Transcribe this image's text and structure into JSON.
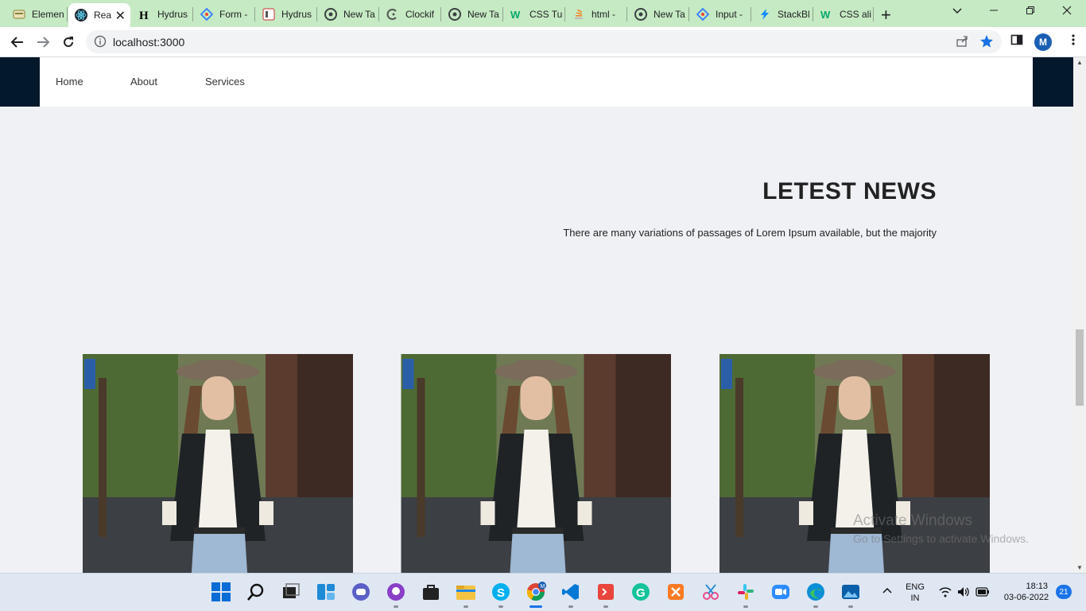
{
  "browser": {
    "tabs": [
      {
        "title": "Elemen",
        "icon": "elementor-icon",
        "active": false
      },
      {
        "title": "Rea",
        "icon": "react-icon",
        "active": true
      },
      {
        "title": "Hydrus",
        "icon": "hydrus-icon",
        "active": false
      },
      {
        "title": "Form -",
        "icon": "google-forms-icon",
        "active": false
      },
      {
        "title": "Hydrus",
        "icon": "hydrus-icon",
        "active": false
      },
      {
        "title": "New Ta",
        "icon": "chrome-icon",
        "active": false
      },
      {
        "title": "Clockif",
        "icon": "clockify-icon",
        "active": false
      },
      {
        "title": "New Ta",
        "icon": "chrome-icon",
        "active": false
      },
      {
        "title": "CSS Tu",
        "icon": "w3schools-icon",
        "active": false
      },
      {
        "title": "html - ",
        "icon": "stackoverflow-icon",
        "active": false
      },
      {
        "title": "New Ta",
        "icon": "chrome-icon",
        "active": false
      },
      {
        "title": "Input -",
        "icon": "google-forms-icon",
        "active": false
      },
      {
        "title": "StackBl",
        "icon": "stackblitz-icon",
        "active": false
      },
      {
        "title": "CSS ali",
        "icon": "w3schools-icon",
        "active": false
      }
    ],
    "url": "localhost:3000",
    "profile_initial": "M"
  },
  "page": {
    "nav": {
      "links": [
        "Home",
        "About",
        "Services"
      ]
    },
    "news": {
      "title": "LETEST NEWS",
      "subtitle": "There are many variations of passages of Lorem Ipsum available, but the majority"
    },
    "cards": [
      {
        "image": "woman-in-hat-street-photo"
      },
      {
        "image": "woman-in-hat-street-photo"
      },
      {
        "image": "woman-in-hat-street-photo"
      }
    ]
  },
  "watermark": {
    "line1": "Activate Windows",
    "line2": "Go to Settings to activate Windows."
  },
  "taskbar": {
    "apps": [
      "windows-start-icon",
      "search-icon",
      "task-view-icon",
      "widgets-icon",
      "teams-chat-icon",
      "github-desktop-icon",
      "store-icon",
      "file-explorer-icon",
      "skype-icon",
      "chrome-icon",
      "vscode-icon",
      "git-icon",
      "grammarly-icon",
      "xampp-icon",
      "snipping-tool-icon",
      "slack-icon",
      "zoom-icon",
      "edge-icon",
      "photos-icon"
    ],
    "language": {
      "line1": "ENG",
      "line2": "IN"
    },
    "time": "18:13",
    "date": "03-06-2022",
    "notifications": "21"
  }
}
